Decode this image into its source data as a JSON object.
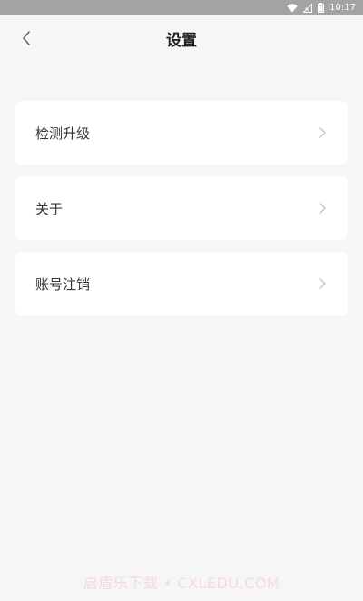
{
  "status_bar": {
    "time": "10:17",
    "icons": [
      "wifi-icon",
      "signal-icon",
      "battery-icon"
    ]
  },
  "header": {
    "title": "设置",
    "back_icon": "chevron-left-icon"
  },
  "settings": {
    "items": [
      {
        "label": "检测升级",
        "icon": "chevron-right-icon"
      },
      {
        "label": "关于",
        "icon": "chevron-right-icon"
      },
      {
        "label": "账号注销",
        "icon": "chevron-right-icon"
      }
    ]
  },
  "watermark": {
    "text": "启盾乐下载 • CXLEDU.COM"
  },
  "colors": {
    "background": "#f6f6f6",
    "status_bar": "#a3a3a3",
    "card": "#ffffff",
    "title": "#222222",
    "label": "#333333",
    "chevron": "#c4c4c4"
  }
}
